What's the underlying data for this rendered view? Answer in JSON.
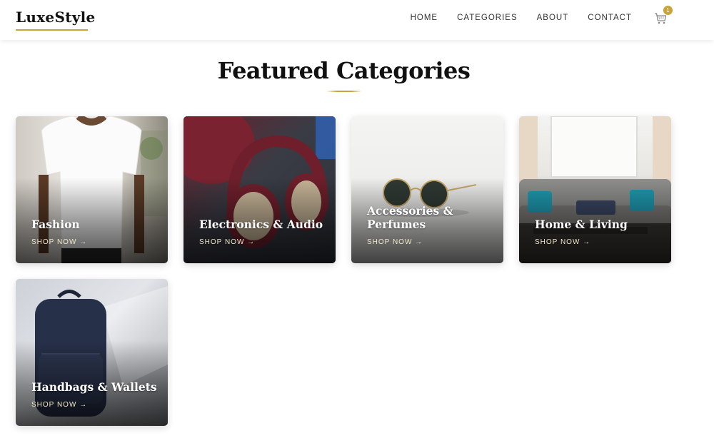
{
  "brand": {
    "name": "LuxeStyle",
    "accent_color": "#c9a43a"
  },
  "nav": {
    "items": [
      "HOME",
      "CATEGORIES",
      "ABOUT",
      "CONTACT"
    ],
    "cart": {
      "icon": "cart-icon",
      "count": "1"
    }
  },
  "section": {
    "title": "Featured Categories"
  },
  "categories": [
    {
      "title": "Fashion",
      "cta": "SHOP NOW →"
    },
    {
      "title": "Electronics & Audio",
      "cta": "SHOP NOW →"
    },
    {
      "title": "Accessories & Perfumes",
      "cta": "SHOP NOW →"
    },
    {
      "title": "Home & Living",
      "cta": "SHOP NOW →"
    },
    {
      "title": "Handbags & Wallets",
      "cta": "SHOP NOW →"
    }
  ]
}
